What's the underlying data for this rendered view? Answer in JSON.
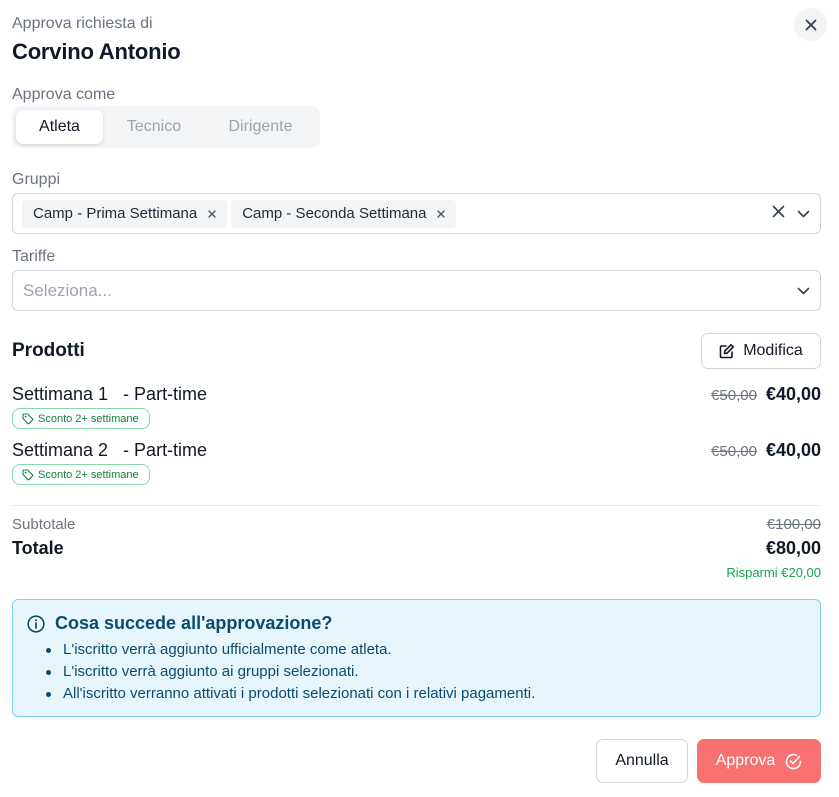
{
  "header": {
    "subtitle": "Approva richiesta di",
    "title": "Corvino Antonio"
  },
  "role": {
    "label": "Approva come",
    "options": [
      "Atleta",
      "Tecnico",
      "Dirigente"
    ],
    "selected": "Atleta"
  },
  "groups": {
    "label": "Gruppi",
    "chips": [
      "Camp - Prima Settimana",
      "Camp - Seconda Settimana"
    ]
  },
  "rates": {
    "label": "Tariffe",
    "placeholder": "Seleziona..."
  },
  "products": {
    "title": "Prodotti",
    "edit_label": "Modifica",
    "items": [
      {
        "name": "Settimana 1   - Part-time",
        "old_price": "€50,00",
        "price": "€40,00",
        "badge": "Sconto 2+ settimane"
      },
      {
        "name": "Settimana 2   - Part-time",
        "old_price": "€50,00",
        "price": "€40,00",
        "badge": "Sconto 2+ settimane"
      }
    ]
  },
  "summary": {
    "subtotal_label": "Subtotale",
    "subtotal_value": "€100,00",
    "total_label": "Totale",
    "total_value": "€80,00",
    "savings": "Risparmi €20,00"
  },
  "info": {
    "title": "Cosa succede all'approvazione?",
    "items": [
      "L'iscritto verrà aggiunto ufficialmente come atleta.",
      "L'iscritto verrà aggiunto ai gruppi selezionati.",
      "All'iscritto verranno attivati i prodotti selezionati con i relativi pagamenti."
    ]
  },
  "footer": {
    "cancel_label": "Annulla",
    "approve_label": "Approva"
  },
  "colors": {
    "accent": "#f87171",
    "info_bg": "#e6f6fc",
    "info_border": "#7dd3fc",
    "success": "#16a34a"
  }
}
